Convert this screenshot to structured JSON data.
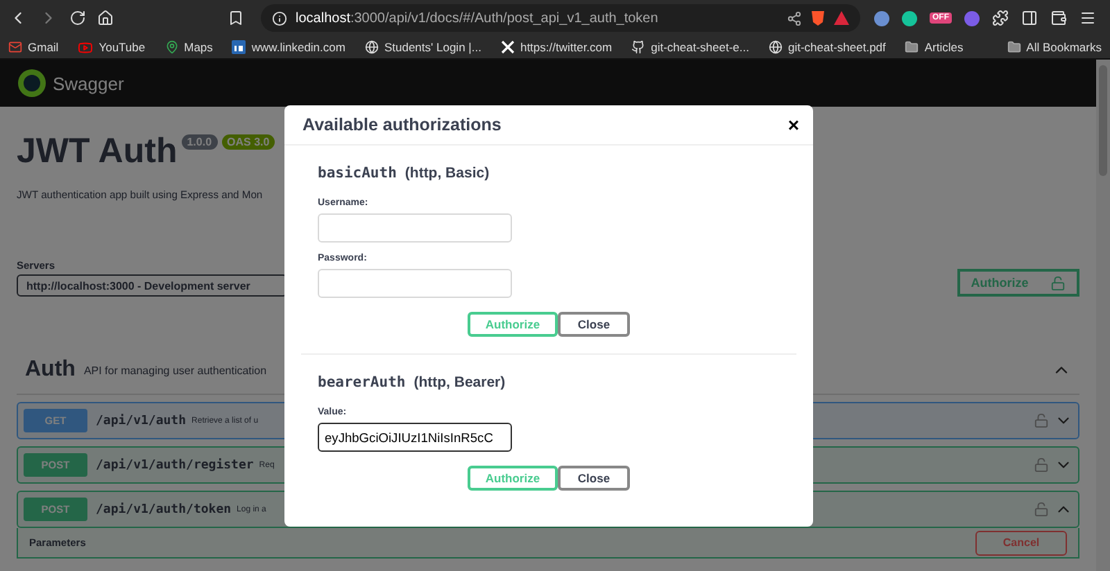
{
  "browser": {
    "address_host": "localhost",
    "address_path": ":3000/api/v1/docs/#/Auth/post_api_v1_auth_token",
    "extension_badge": "OFF",
    "bookmarks": [
      {
        "label": "Gmail",
        "kind": "mail"
      },
      {
        "label": "YouTube",
        "kind": "video"
      },
      {
        "label": "Maps",
        "kind": "pin"
      },
      {
        "label": "www.linkedin.com",
        "kind": "in"
      },
      {
        "label": "Students' Login |...",
        "kind": "globe"
      },
      {
        "label": "https://twitter.com",
        "kind": "x"
      },
      {
        "label": "git-cheat-sheet-e...",
        "kind": "cat"
      },
      {
        "label": "git-cheat-sheet.pdf",
        "kind": "globe"
      },
      {
        "label": "Articles",
        "kind": "folder"
      }
    ],
    "all_bookmarks": "All Bookmarks"
  },
  "page": {
    "brand": "Swagger",
    "title": "JWT Auth",
    "version": "1.0.0",
    "oas": "OAS 3.0",
    "description": "JWT authentication app built using Express and Mon",
    "servers_label": "Servers",
    "server": "http://localhost:3000 - Development server",
    "authorize": "Authorize",
    "tag": {
      "name": "Auth",
      "description": "API for managing user authentication",
      "expanded": true
    },
    "operations": [
      {
        "method": "GET",
        "kind": "get",
        "path": "/api/v1/auth",
        "summary": "Retrieve a list of u",
        "expanded": false
      },
      {
        "method": "POST",
        "kind": "post",
        "path": "/api/v1/auth/register",
        "summary": "Req",
        "expanded": false
      },
      {
        "method": "POST",
        "kind": "post",
        "path": "/api/v1/auth/token",
        "summary": "Log in a",
        "expanded": true
      }
    ],
    "parameters": "Parameters",
    "cancel": "Cancel"
  },
  "modal": {
    "title": "Available authorizations",
    "close": "×",
    "schemes": [
      {
        "name": "basicAuth",
        "meta": "(http, Basic)",
        "fields": [
          {
            "label": "Username:",
            "focused": false
          },
          {
            "label": "Password:",
            "focused": false
          }
        ],
        "authorize": "Authorize",
        "close": "Close"
      },
      {
        "name": "bearerAuth",
        "meta": "(http, Bearer)",
        "fields": [
          {
            "label": "Value:",
            "value": "eyJhbGciOiJIUzI1NiIsInR5cC",
            "focused": true
          }
        ],
        "authorize": "Authorize",
        "close": "Close"
      }
    ]
  }
}
